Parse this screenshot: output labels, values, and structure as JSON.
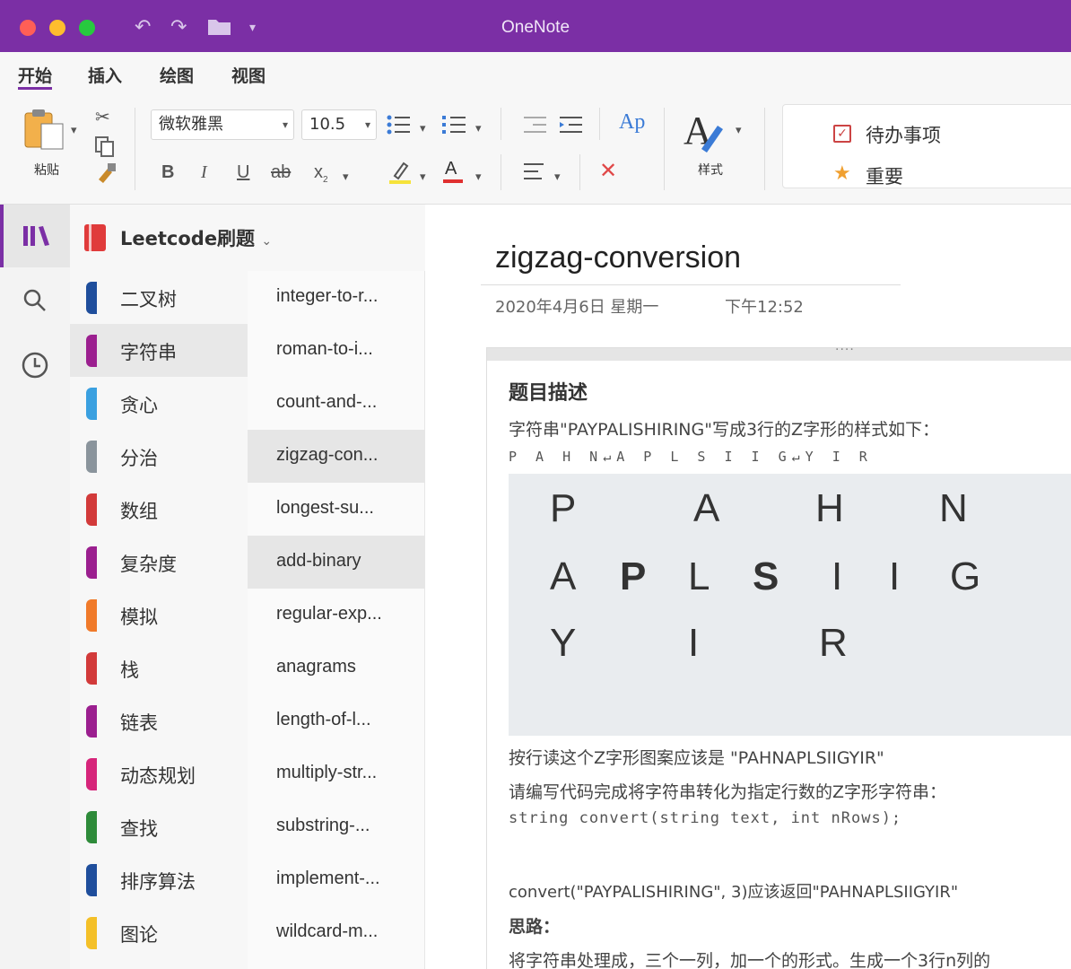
{
  "app": {
    "title": "OneNote"
  },
  "ribbon": {
    "tabs": [
      "开始",
      "插入",
      "绘图",
      "视图"
    ]
  },
  "toolbar": {
    "paste_label": "粘贴",
    "font_name": "微软雅黑",
    "font_size": "10.5",
    "styles_label": "样式",
    "todo_label": "待办事项",
    "important_label": "重要"
  },
  "notebook": {
    "name": "Leetcode刷题"
  },
  "sections": [
    {
      "name": "二叉树",
      "color": "#1f4e9c"
    },
    {
      "name": "字符串",
      "color": "#9b1f8f"
    },
    {
      "name": "贪心",
      "color": "#3aa0e0"
    },
    {
      "name": "分治",
      "color": "#8a949c"
    },
    {
      "name": "数组",
      "color": "#d23a3a"
    },
    {
      "name": "复杂度",
      "color": "#9b1f8f"
    },
    {
      "name": "模拟",
      "color": "#f07a2a"
    },
    {
      "name": "栈",
      "color": "#d23a3a"
    },
    {
      "name": "链表",
      "color": "#9b1f8f"
    },
    {
      "name": "动态规划",
      "color": "#d6257a"
    },
    {
      "name": "查找",
      "color": "#2e8b3a"
    },
    {
      "name": "排序算法",
      "color": "#1f4e9c"
    },
    {
      "name": "图论",
      "color": "#f4c028"
    }
  ],
  "pages": [
    "integer-to-r...",
    "roman-to-i...",
    "count-and-...",
    "zigzag-con...",
    "longest-su...",
    "add-binary",
    "regular-exp...",
    "anagrams",
    "length-of-l...",
    "multiply-str...",
    "substring-...",
    "implement-...",
    "wildcard-m..."
  ],
  "page": {
    "title": "zigzag-conversion",
    "date": "2020年4月6日 星期一",
    "time": "下午12:52",
    "heading": "题目描述",
    "line1": "字符串\"PAYPALISHIRING\"写成3行的Z字形的样式如下：",
    "line_mono": "P  A  H  N↵A P L S I I G↵Y  I  R",
    "line_read": "按行读这个Z字形图案应该是 \"PAHNAPLSIIGYIR\"",
    "line_write": "请编写代码完成将字符串转化为指定行数的Z字形字符串：",
    "line_sig": "string convert(string text, int nRows);",
    "line_example": "convert(\"PAYPALISHIRING\", 3)应该返回\"PAHNAPLSIIGYIR\"",
    "line_idea": "思路：",
    "line_idea_text": "将字符串处理成，三个一列，加一个的形式。生成一个3行n列的",
    "zigzag": {
      "row1": [
        "P",
        "A",
        "H",
        "N"
      ],
      "row2": [
        "A",
        "P",
        "L",
        "S",
        "I",
        "I",
        "G"
      ],
      "row3": [
        "Y",
        "I",
        "R"
      ]
    }
  }
}
